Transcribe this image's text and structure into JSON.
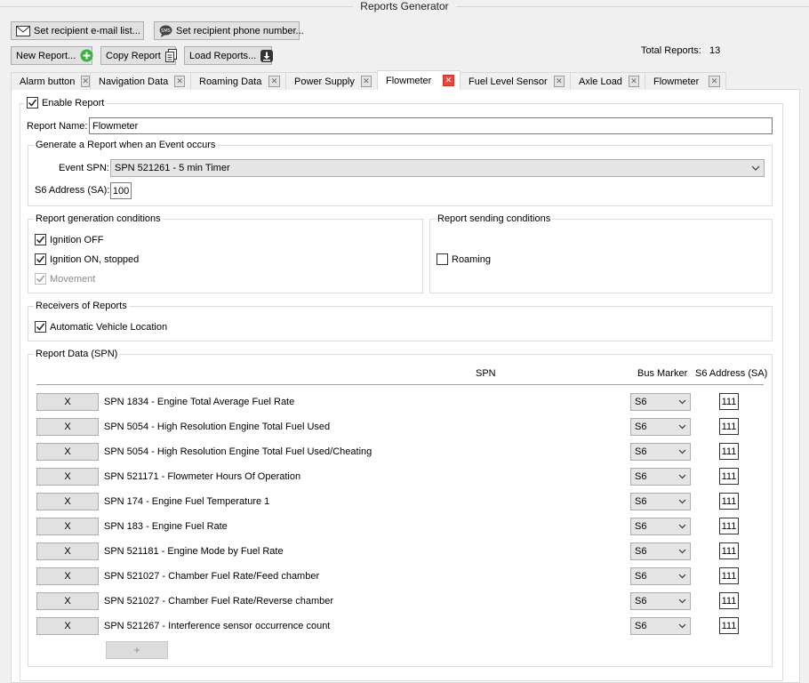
{
  "window": {
    "title": "Reports Generator"
  },
  "toolbar": {
    "set_email_label": "Set recipient e-mail list...",
    "set_phone_label": "Set recipient phone number...",
    "new_report_label": "New Report...",
    "copy_report_label": "Copy Report",
    "load_reports_label": "Load Reports...",
    "total_label": "Total Reports:",
    "total_value": "13"
  },
  "tabs": [
    {
      "label": "Alarm button"
    },
    {
      "label": "Navigation Data"
    },
    {
      "label": "Roaming Data"
    },
    {
      "label": "Power Supply"
    },
    {
      "label": "Flowmeter",
      "active": true
    },
    {
      "label": "Fuel Level Sensor"
    },
    {
      "label": "Axle Load"
    },
    {
      "label": "Flowmeter"
    }
  ],
  "form": {
    "enable_label": "Enable Report",
    "enable_checked": true,
    "report_name_label": "Report Name:",
    "report_name_value": "Flowmeter",
    "event_group_title": "Generate a Report when an Event occurs",
    "event_spn_label": "Event SPN:",
    "event_spn_value": "SPN 521261 - 5 min Timer",
    "sa_label": "S6 Address (SA):",
    "sa_value": "100",
    "gen_conditions_title": "Report generation conditions",
    "ignition_off_label": "Ignition OFF",
    "ignition_on_label": "Ignition ON, stopped",
    "movement_label": "Movement",
    "send_conditions_title": "Report sending conditions",
    "roaming_label": "Roaming",
    "receivers_title": "Receivers of Reports",
    "avl_label": "Automatic Vehicle Location"
  },
  "report_data": {
    "title": "Report Data (SPN)",
    "col_spn": "SPN",
    "col_bus": "Bus Marker",
    "col_sa": "S6 Address (SA)",
    "remove_label": "X",
    "add_label": "+",
    "rows": [
      {
        "spn": "SPN 1834 - Engine Total Average Fuel Rate",
        "bus": "S6",
        "sa": "111"
      },
      {
        "spn": "SPN 5054 - High Resolution Engine Total Fuel Used",
        "bus": "S6",
        "sa": "111"
      },
      {
        "spn": "SPN 5054 - High Resolution Engine Total Fuel Used/Cheating",
        "bus": "S6",
        "sa": "111"
      },
      {
        "spn": "SPN 521171 - Flowmeter Hours Of Operation",
        "bus": "S6",
        "sa": "111"
      },
      {
        "spn": "SPN 174 - Engine Fuel Temperature 1",
        "bus": "S6",
        "sa": "111"
      },
      {
        "spn": "SPN 183 - Engine Fuel Rate",
        "bus": "S6",
        "sa": "111"
      },
      {
        "spn": "SPN 521181 - Engine Mode by Fuel Rate",
        "bus": "S6",
        "sa": "111"
      },
      {
        "spn": "SPN 521027 - Chamber Fuel Rate/Feed chamber",
        "bus": "S6",
        "sa": "111"
      },
      {
        "spn": "SPN 521027 - Chamber Fuel Rate/Reverse chamber",
        "bus": "S6",
        "sa": "111"
      },
      {
        "spn": "SPN 521267 - Interference sensor occurrence count",
        "bus": "S6",
        "sa": "111"
      }
    ]
  }
}
